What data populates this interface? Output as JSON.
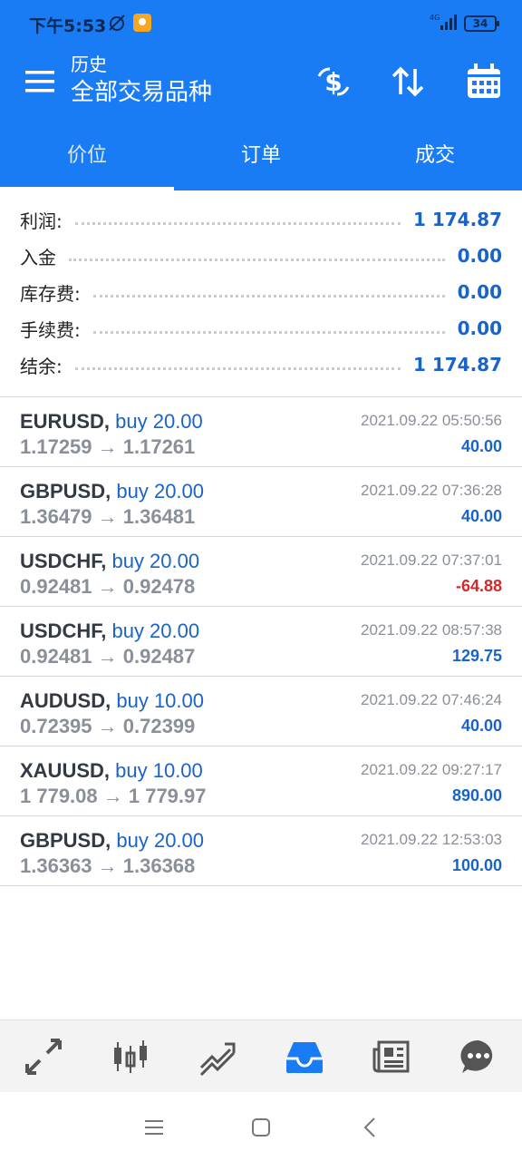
{
  "status_bar": {
    "time": "下午5:53",
    "battery": "34",
    "network": "4G"
  },
  "toolbar": {
    "subtitle": "历史",
    "title": "全部交易品种",
    "icons": [
      "menu-icon",
      "currency-exchange-icon",
      "sort-icon",
      "calendar-icon"
    ]
  },
  "tabs": [
    {
      "label": "价位",
      "active": true
    },
    {
      "label": "订单",
      "active": false
    },
    {
      "label": "成交",
      "active": false
    }
  ],
  "summary": [
    {
      "label": "利润:",
      "value": "1 174.87"
    },
    {
      "label": "入金",
      "value": "0.00"
    },
    {
      "label": "库存费:",
      "value": "0.00"
    },
    {
      "label": "手续费:",
      "value": "0.00"
    },
    {
      "label": "结余:",
      "value": "1 174.87"
    }
  ],
  "deals": [
    {
      "symbol": "EURUSD,",
      "side": "buy 20.00",
      "prices": "1.17259 → 1.17261",
      "time": "2021.09.22 05:50:56",
      "profit": "40.00"
    },
    {
      "symbol": "GBPUSD,",
      "side": "buy 20.00",
      "prices": "1.36479 → 1.36481",
      "time": "2021.09.22 07:36:28",
      "profit": "40.00"
    },
    {
      "symbol": "USDCHF,",
      "side": "buy 20.00",
      "prices": "0.92481 → 0.92478",
      "time": "2021.09.22 07:37:01",
      "profit": "-64.88"
    },
    {
      "symbol": "USDCHF,",
      "side": "buy 20.00",
      "prices": "0.92481 → 0.92487",
      "time": "2021.09.22 08:57:38",
      "profit": "129.75"
    },
    {
      "symbol": "AUDUSD,",
      "side": "buy 10.00",
      "prices": "0.72395 → 0.72399",
      "time": "2021.09.22 07:46:24",
      "profit": "40.00"
    },
    {
      "symbol": "XAUUSD,",
      "side": "buy 10.00",
      "prices": "1 779.08 → 1 779.97",
      "time": "2021.09.22 09:27:17",
      "profit": "890.00"
    },
    {
      "symbol": "GBPUSD,",
      "side": "buy 20.00",
      "prices": "1.36363 → 1.36368",
      "time": "2021.09.22 12:53:03",
      "profit": "100.00"
    }
  ],
  "bottom_nav": [
    "quotes-icon",
    "chart-icon",
    "trade-icon",
    "history-icon",
    "news-icon",
    "chat-icon"
  ],
  "colors": {
    "header": "#1a7cf5",
    "accent": "#1a63c8",
    "negative": "#d12a2a"
  }
}
